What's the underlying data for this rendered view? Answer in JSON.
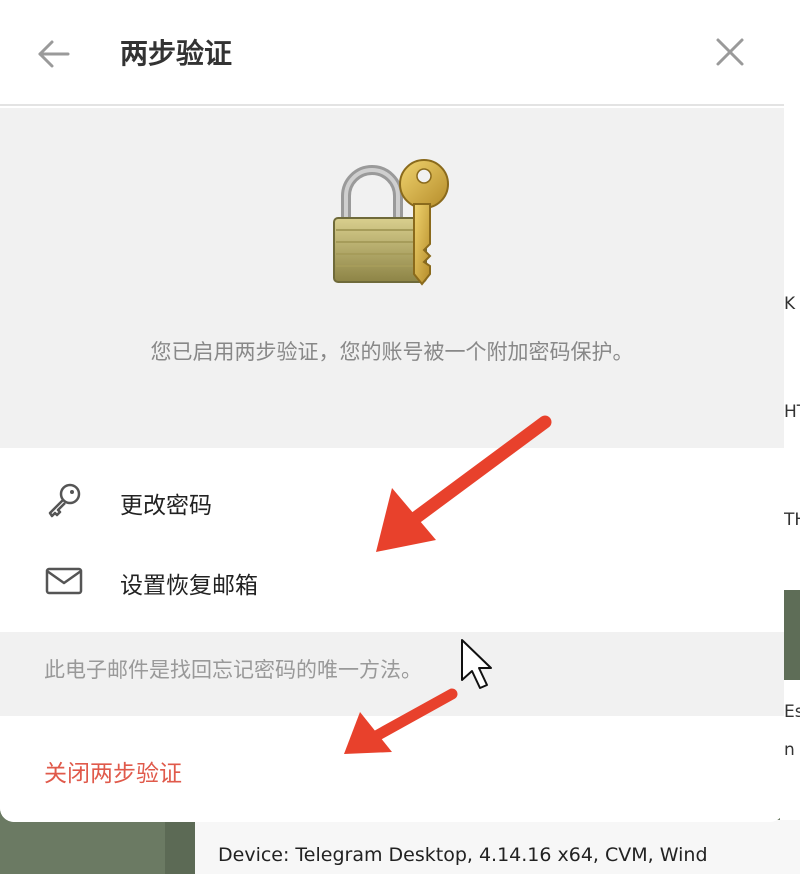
{
  "dialog": {
    "title": "两步验证",
    "back_icon": "arrow-left-icon",
    "close_icon": "close-icon",
    "illustration": "padlock-key-icon",
    "description": "您已启用两步验证，您的账号被一个附加密码保护。",
    "menu": [
      {
        "label": "更改密码",
        "icon": "key-icon"
      },
      {
        "label": "设置恢复邮箱",
        "icon": "envelope-icon"
      }
    ],
    "hint": "此电子邮件是找回忘记密码的唯一方法。",
    "disable_label": "关闭两步验证"
  },
  "background": {
    "device_text": "Device: Telegram Desktop, 4.14.16 x64, CVM, Wind",
    "edge_fragments": [
      "K",
      "HT",
      "TH",
      "Es",
      "n"
    ]
  },
  "colors": {
    "danger": "#e05a4b",
    "annotation_arrow": "#e8412c",
    "backdrop": "#6b7a63"
  }
}
